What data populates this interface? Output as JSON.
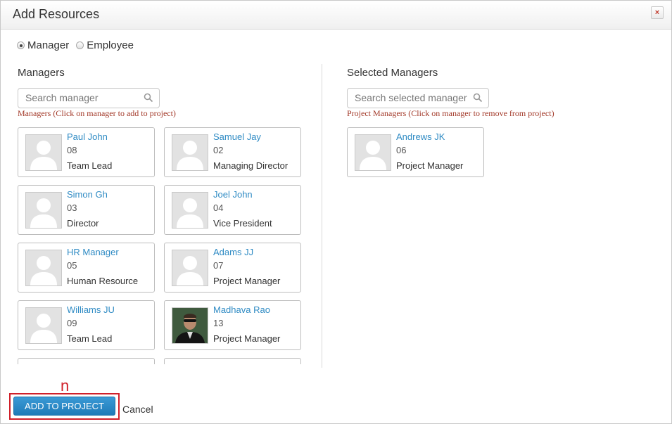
{
  "dialog": {
    "title": "Add Resources",
    "close_label": "×"
  },
  "radio": {
    "manager_label": "Manager",
    "employee_label": "Employee",
    "selected": "Manager"
  },
  "left": {
    "title": "Managers",
    "search_placeholder": "Search manager",
    "hint": "Managers (Click on manager to add to project)",
    "cards": [
      {
        "name": "Paul John",
        "id": "08",
        "role": "Team Lead",
        "photo": "placeholder"
      },
      {
        "name": "Samuel Jay",
        "id": "02",
        "role": "Managing Director",
        "photo": "placeholder"
      },
      {
        "name": "Simon Gh",
        "id": "03",
        "role": "Director",
        "photo": "placeholder"
      },
      {
        "name": "Joel John",
        "id": "04",
        "role": "Vice President",
        "photo": "placeholder"
      },
      {
        "name": "HR Manager",
        "id": "05",
        "role": "Human Resource",
        "photo": "placeholder"
      },
      {
        "name": "Adams JJ",
        "id": "07",
        "role": "Project Manager",
        "photo": "placeholder"
      },
      {
        "name": "Williams JU",
        "id": "09",
        "role": "Team Lead",
        "photo": "placeholder"
      },
      {
        "name": "Madhava Rao",
        "id": "13",
        "role": "Project Manager",
        "photo": "portrait"
      }
    ]
  },
  "right": {
    "title": "Selected Managers",
    "search_placeholder": "Search selected manager",
    "hint": "Project Managers (Click on manager to remove from project)",
    "cards": [
      {
        "name": "Andrews JK",
        "id": "06",
        "role": "Project Manager",
        "photo": "placeholder"
      }
    ]
  },
  "footer": {
    "add_label": "ADD TO PROJECT",
    "cancel_label": "Cancel",
    "annotation": "n"
  },
  "colors": {
    "link": "#2f8bc4",
    "hint": "#a33a2a",
    "button": "#2a8ccb",
    "highlight": "#d0202a"
  }
}
